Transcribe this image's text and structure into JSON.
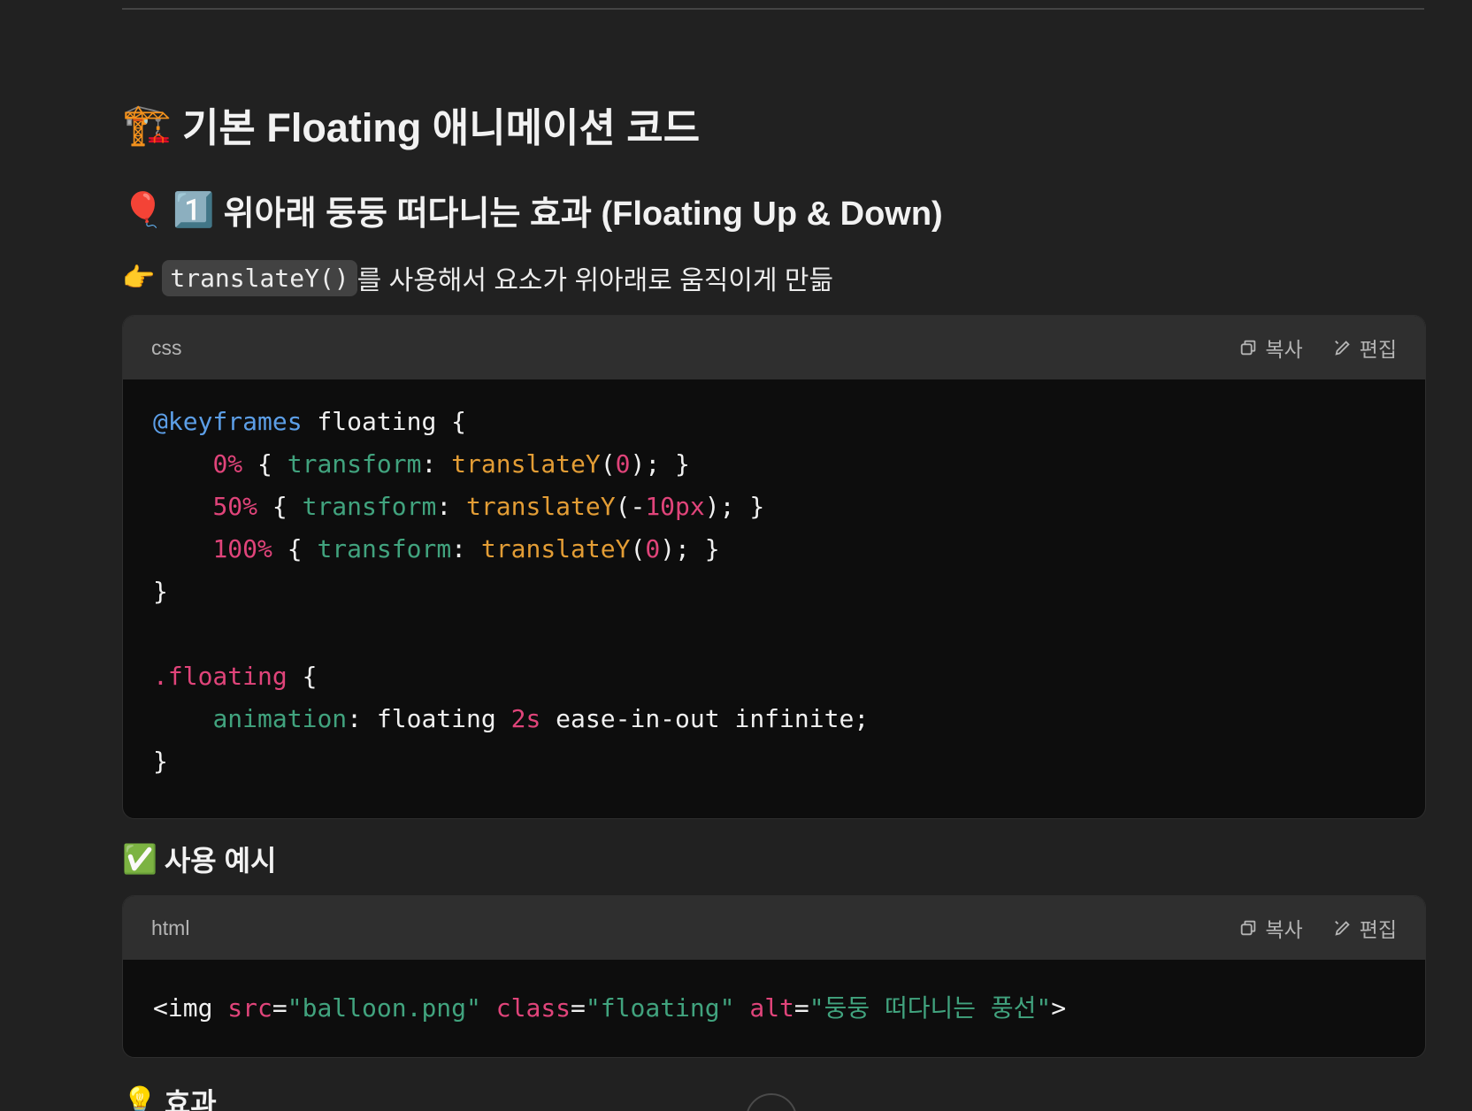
{
  "section": {
    "heading_emoji": "🏗️",
    "heading": "기본 Floating 애니메이션 코드"
  },
  "subsection": {
    "emoji": "🎈",
    "number_emoji": "1️⃣",
    "heading": "위아래 둥둥 떠다니는 효과 (Floating Up & Down)"
  },
  "intro": {
    "emoji": "👉",
    "code": "translateY()",
    "text": "를 사용해서 요소가 위아래로 움직이게 만듦"
  },
  "css_block": {
    "language": "css",
    "copy_label": "복사",
    "edit_label": "편집",
    "lines": [
      [
        {
          "t": "@keyframes",
          "c": "blue"
        },
        {
          "t": " floating {",
          "c": ""
        }
      ],
      [
        {
          "t": "    ",
          "c": ""
        },
        {
          "t": "0%",
          "c": "pink"
        },
        {
          "t": " { ",
          "c": ""
        },
        {
          "t": "transform",
          "c": "green"
        },
        {
          "t": ": ",
          "c": ""
        },
        {
          "t": "translateY",
          "c": "orange"
        },
        {
          "t": "(",
          "c": ""
        },
        {
          "t": "0",
          "c": "pink"
        },
        {
          "t": "); }",
          "c": ""
        }
      ],
      [
        {
          "t": "    ",
          "c": ""
        },
        {
          "t": "50%",
          "c": "pink"
        },
        {
          "t": " { ",
          "c": ""
        },
        {
          "t": "transform",
          "c": "green"
        },
        {
          "t": ": ",
          "c": ""
        },
        {
          "t": "translateY",
          "c": "orange"
        },
        {
          "t": "(-",
          "c": ""
        },
        {
          "t": "10px",
          "c": "pink"
        },
        {
          "t": "); }",
          "c": ""
        }
      ],
      [
        {
          "t": "    ",
          "c": ""
        },
        {
          "t": "100%",
          "c": "pink"
        },
        {
          "t": " { ",
          "c": ""
        },
        {
          "t": "transform",
          "c": "green"
        },
        {
          "t": ": ",
          "c": ""
        },
        {
          "t": "translateY",
          "c": "orange"
        },
        {
          "t": "(",
          "c": ""
        },
        {
          "t": "0",
          "c": "pink"
        },
        {
          "t": "); }",
          "c": ""
        }
      ],
      [
        {
          "t": "}",
          "c": ""
        }
      ],
      [
        {
          "t": "",
          "c": ""
        }
      ],
      [
        {
          "t": ".floating",
          "c": "pink"
        },
        {
          "t": " {",
          "c": ""
        }
      ],
      [
        {
          "t": "    ",
          "c": ""
        },
        {
          "t": "animation",
          "c": "green"
        },
        {
          "t": ": floating ",
          "c": ""
        },
        {
          "t": "2s",
          "c": "pink"
        },
        {
          "t": " ease-in-out infinite;",
          "c": ""
        }
      ],
      [
        {
          "t": "}",
          "c": ""
        }
      ]
    ]
  },
  "example": {
    "emoji": "✅",
    "heading": "사용 예시"
  },
  "html_block": {
    "language": "html",
    "copy_label": "복사",
    "edit_label": "편집",
    "lines": [
      [
        {
          "t": "<img ",
          "c": ""
        },
        {
          "t": "src",
          "c": "attr"
        },
        {
          "t": "=",
          "c": ""
        },
        {
          "t": "\"balloon.png\"",
          "c": "str"
        },
        {
          "t": " ",
          "c": ""
        },
        {
          "t": "class",
          "c": "attr"
        },
        {
          "t": "=",
          "c": ""
        },
        {
          "t": "\"floating\"",
          "c": "str"
        },
        {
          "t": " ",
          "c": ""
        },
        {
          "t": "alt",
          "c": "attr"
        },
        {
          "t": "=",
          "c": ""
        },
        {
          "t": "\"둥둥 떠다니는 풍선\"",
          "c": "str"
        },
        {
          "t": ">",
          "c": ""
        }
      ]
    ]
  },
  "effect": {
    "emoji": "💡",
    "heading": "효과"
  },
  "colors": {
    "background": "#212121",
    "code_bg": "#0d0d0d",
    "header_bg": "#2f2f2f",
    "keyword_blue": "#5c9ee6",
    "number_pink": "#e0447a",
    "property_green": "#41a37e",
    "function_orange": "#e39d35"
  }
}
